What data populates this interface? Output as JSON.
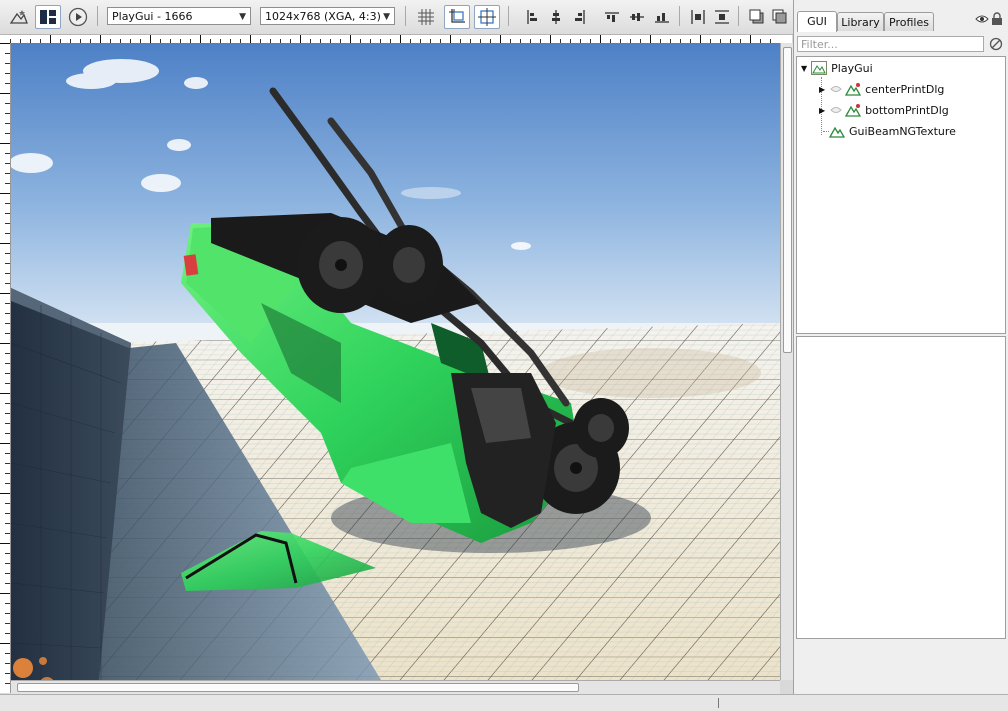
{
  "toolbar": {
    "gui_select": "PlayGui - 1666",
    "resolution_select": "1024x768 (XGA, 4:3)"
  },
  "side_panel": {
    "tabs": [
      "GUI",
      "Library",
      "Profiles"
    ],
    "filter_placeholder": "Filter...",
    "tree": [
      {
        "label": "PlayGui",
        "level": 0,
        "expanded": true
      },
      {
        "label": "centerPrintDlg",
        "level": 1,
        "expanded": false
      },
      {
        "label": "bottomPrintDlg",
        "level": 1,
        "expanded": false
      },
      {
        "label": "GuiBeamNGTexture",
        "level": 1
      }
    ]
  },
  "colors": {
    "accent_green": "#2fd35c",
    "sky_top": "#4d80c6",
    "sky_horizon": "#dbe8f4"
  }
}
